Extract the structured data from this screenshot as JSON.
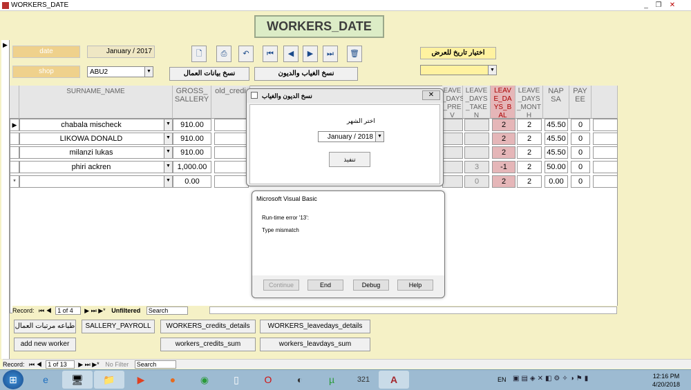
{
  "window": {
    "title": "WORKERS_DATE"
  },
  "form": {
    "title": "WORKERS_DATE",
    "date_label": "date",
    "date_value": "January / 2017",
    "shop_label": "shop",
    "shop_value": "ABU2",
    "choose_date_label": "اختيار تاريخ للعرض",
    "copy_workers_btn": "نسخ بيانات العمال",
    "copy_absence_btn": "نسخ الغياب والديون"
  },
  "columns": [
    "SURNAME_NAME",
    "GROSS_ SALLERY",
    "old_credi",
    "EAVE _DAYS _PRE V",
    "LEAVE _DAYS _TAKE N",
    "LEAV E_DA YS_B AL",
    "LEAVE _DAYS _MONT H",
    "NAP SA",
    "PAY EE"
  ],
  "rows": [
    {
      "name": "chabala mischeck",
      "gross": "910.00",
      "taken": "",
      "bal": "2",
      "month": "2",
      "napsa": "45.50",
      "payee": "0"
    },
    {
      "name": "LIKOWA DONALD",
      "gross": "910.00",
      "taken": "",
      "bal": "2",
      "month": "2",
      "napsa": "45.50",
      "payee": "0"
    },
    {
      "name": "milanzi lukas",
      "gross": "910.00",
      "taken": "",
      "bal": "2",
      "month": "2",
      "napsa": "45.50",
      "payee": "0"
    },
    {
      "name": "phiri ackren",
      "gross": "1,000.00",
      "taken": "3",
      "bal": "-1",
      "month": "2",
      "napsa": "50.00",
      "payee": "0"
    },
    {
      "name": "",
      "gross": "0.00",
      "taken": "0",
      "bal": "2",
      "month": "2",
      "napsa": "0.00",
      "payee": "0"
    }
  ],
  "subform_record": {
    "label": "Record:",
    "pos": "1 of 4",
    "filter": "Unfiltered",
    "search": "Search"
  },
  "main_record": {
    "label": "Record:",
    "pos": "1 of 13",
    "filter": "No Filter",
    "search": "Search"
  },
  "bottom_buttons": {
    "print_salaries": "طباعه مرتبات العمال",
    "sallery_payroll": "SALLERY_PAYROLL",
    "credits_details": "WORKERS_credits_details",
    "leavedays_details": "WORKERS_leavedays_details",
    "add_worker": "add new worker",
    "credits_sum": "workers_credits_sum",
    "leavdays_sum": "workers_leavdays_sum"
  },
  "copy_dialog": {
    "title": "نسخ الديون والغياب",
    "month_label": "اختر الشهر",
    "month_value": "January / 2018",
    "execute_btn": "تنفيذ"
  },
  "vb_dialog": {
    "title": "Microsoft Visual Basic",
    "error": "Run-time error '13':",
    "message": "Type mismatch",
    "continue": "Continue",
    "end": "End",
    "debug": "Debug",
    "help": "Help"
  },
  "taskbar": {
    "lang": "EN",
    "time": "12:16 PM",
    "date": "4/20/2018"
  }
}
